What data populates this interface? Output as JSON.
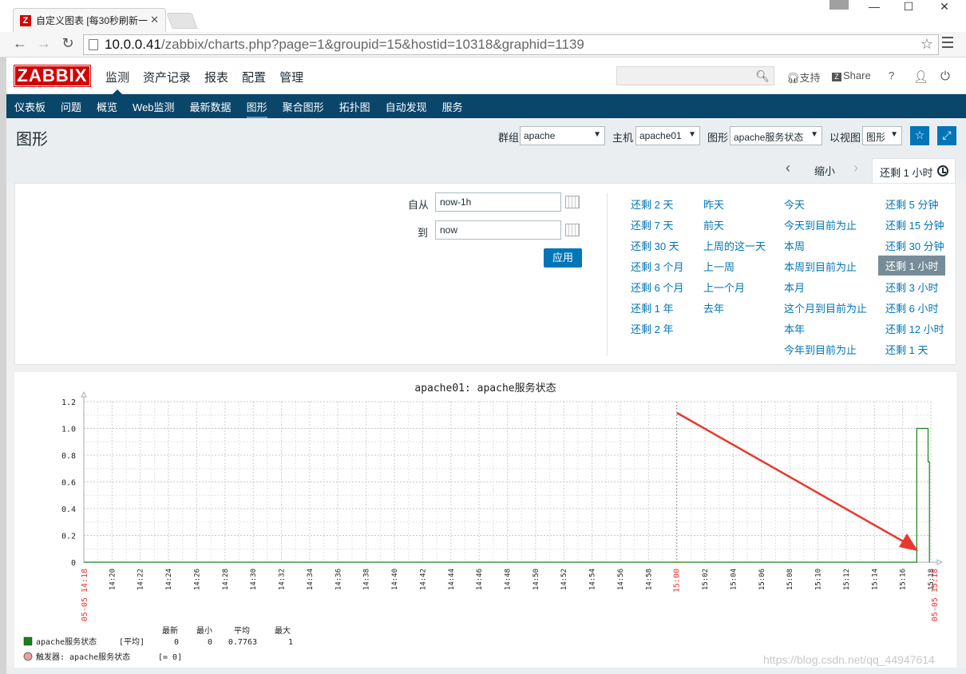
{
  "browser": {
    "tab_title": "自定义图表 [每30秒刷新一",
    "favicon": "Z",
    "url_host": "10.0.0.41",
    "url_rest": "/zabbix/charts.php?page=1&groupid=15&hostid=10318&graphid=1139"
  },
  "header": {
    "logo": "ZABBIX",
    "menu": [
      "监测",
      "资产记录",
      "报表",
      "配置",
      "管理"
    ],
    "support": "支持",
    "share": "Share",
    "help": "?"
  },
  "submenu": [
    "仪表板",
    "问题",
    "概览",
    "Web监测",
    "最新数据",
    "图形",
    "聚合图形",
    "拓扑图",
    "自动发现",
    "服务"
  ],
  "page": {
    "title": "图形",
    "group_label": "群组",
    "group_value": "apache",
    "host_label": "主机",
    "host_value": "apache01",
    "graph_label": "图形",
    "graph_value": "apache服务状态",
    "view_label": "以视图",
    "view_value": "图形"
  },
  "timebar": {
    "zoom_out": "缩小",
    "active_tab": "还剩 1 小时"
  },
  "filter": {
    "from_label": "自从",
    "from_value": "now-1h",
    "to_label": "到",
    "to_value": "now",
    "apply": "应用",
    "quick_columns": [
      [
        "还剩 2 天",
        "还剩 7 天",
        "还剩 30 天",
        "还剩 3 个月",
        "还剩 6 个月",
        "还剩 1 年",
        "还剩 2 年"
      ],
      [
        "昨天",
        "前天",
        "上周的这一天",
        "上一周",
        "上一个月",
        "去年"
      ],
      [
        "今天",
        "今天到目前为止",
        "本周",
        "本周到目前为止",
        "本月",
        "这个月到目前为止",
        "本年",
        "今年到目前为止"
      ],
      [
        "还剩 5 分钟",
        "还剩 15 分钟",
        "还剩 30 分钟",
        "还剩 1 小时",
        "还剩 3 小时",
        "还剩 6 小时",
        "还剩 12 小时",
        "还剩 1 天"
      ]
    ],
    "selected_quick": "还剩 1 小时"
  },
  "chart_data": {
    "type": "line",
    "title": "apache01: apache服务状态",
    "ylim": [
      0,
      1.2
    ],
    "yticks": [
      "0",
      "0.2",
      "0.4",
      "0.6",
      "0.8",
      "1.0",
      "1.2"
    ],
    "x_start_label": "05-05 14:18",
    "x_end_label": "05-05 15:18",
    "xticks": [
      "14:20",
      "14:22",
      "14:24",
      "14:26",
      "14:28",
      "14:30",
      "14:32",
      "14:34",
      "14:36",
      "14:38",
      "14:40",
      "14:42",
      "14:44",
      "14:46",
      "14:48",
      "14:50",
      "14:52",
      "14:54",
      "14:56",
      "14:58",
      "15:00",
      "15:02",
      "15:04",
      "15:06",
      "15:08",
      "15:10",
      "15:12",
      "15:14",
      "15:16",
      "15:18"
    ],
    "highlight_tick": "15:00",
    "series": [
      {
        "name": "apache服务状态",
        "color": "#1a7f1a",
        "x_minutes": [
          0,
          59.0,
          59.0,
          59.8,
          59.8,
          59.9,
          59.9
        ],
        "y": [
          0,
          0,
          1.0,
          1.0,
          0.75,
          0.75,
          0
        ]
      }
    ],
    "legend": {
      "headers": [
        "最新",
        "最小",
        "平均",
        "最大"
      ],
      "series_label": "apache服务状态",
      "func": "[平均]",
      "last": "0",
      "min": "0",
      "avg": "0.7763",
      "max": "1",
      "trigger_label": "触发器: apache服务状态",
      "trigger_value": "[= 0]",
      "trigger_color": "#e8a0a0"
    },
    "grid": true
  },
  "watermark": "https://blog.csdn.net/qq_44947614"
}
